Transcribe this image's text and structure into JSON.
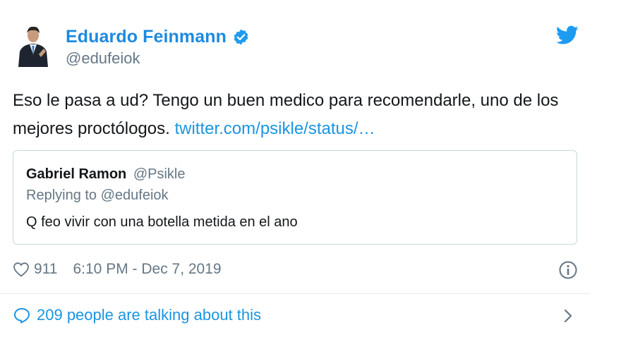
{
  "author": {
    "name": "Eduardo Feinmann",
    "handle": "@edufeiok",
    "verified": true
  },
  "tweet": {
    "text": "Eso le pasa a ud? Tengo un buen medico para recomendarle, uno de los mejores proctólogos.",
    "link_text": "twitter.com/psikle/status/…"
  },
  "quoted": {
    "name": "Gabriel Ramon",
    "handle": "@Psikle",
    "replying_to": "Replying to @edufeiok",
    "text": "Q feo vivir con una botella metida en el ano"
  },
  "meta": {
    "likes": "911",
    "timestamp": "6:10 PM - Dec 7, 2019"
  },
  "footer": {
    "talking_text": "209 people are talking about this"
  },
  "icons": {
    "verified": "verified-badge-icon",
    "bird": "twitter-bird-icon",
    "heart": "heart-icon",
    "info": "info-icon",
    "bubble": "comment-bubble-icon",
    "chevron": "chevron-right-icon"
  },
  "colors": {
    "name_blue": "#1d8ae0",
    "link_blue": "#1b95e0",
    "muted": "#657786",
    "border": "#ccd6dd"
  }
}
